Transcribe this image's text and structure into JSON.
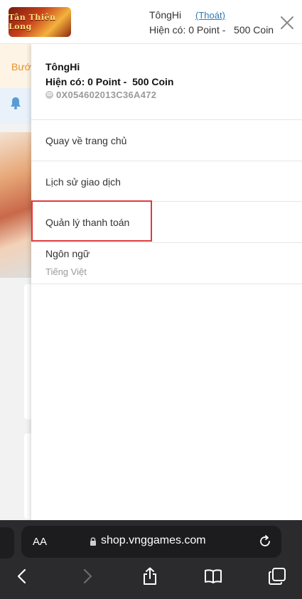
{
  "header": {
    "logo_text": "Tân Thiên Long",
    "username": "TôngHi",
    "logout_label": "(Thoát)",
    "balance": "Hiện có: 0 Point -   500 Coin"
  },
  "background": {
    "step_text": "Bướ"
  },
  "drawer": {
    "profile": {
      "name": "TôngHi",
      "balance": "Hiện có: 0 Point -  500 Coin",
      "id_badge": "ID",
      "id": "0X054602013C36A472"
    },
    "menu": {
      "home": "Quay về trang chủ",
      "history": "Lịch sử giao dịch",
      "payment": "Quản lý thanh toán"
    },
    "language": {
      "label": "Ngôn ngữ",
      "value": "Tiếng Việt"
    }
  },
  "browser": {
    "text_size_label": "AA",
    "url": "shop.vnggames.com"
  },
  "colors": {
    "highlight": "#e03a3e",
    "link": "#2a7bb8",
    "accent_orange": "#e8912b"
  }
}
